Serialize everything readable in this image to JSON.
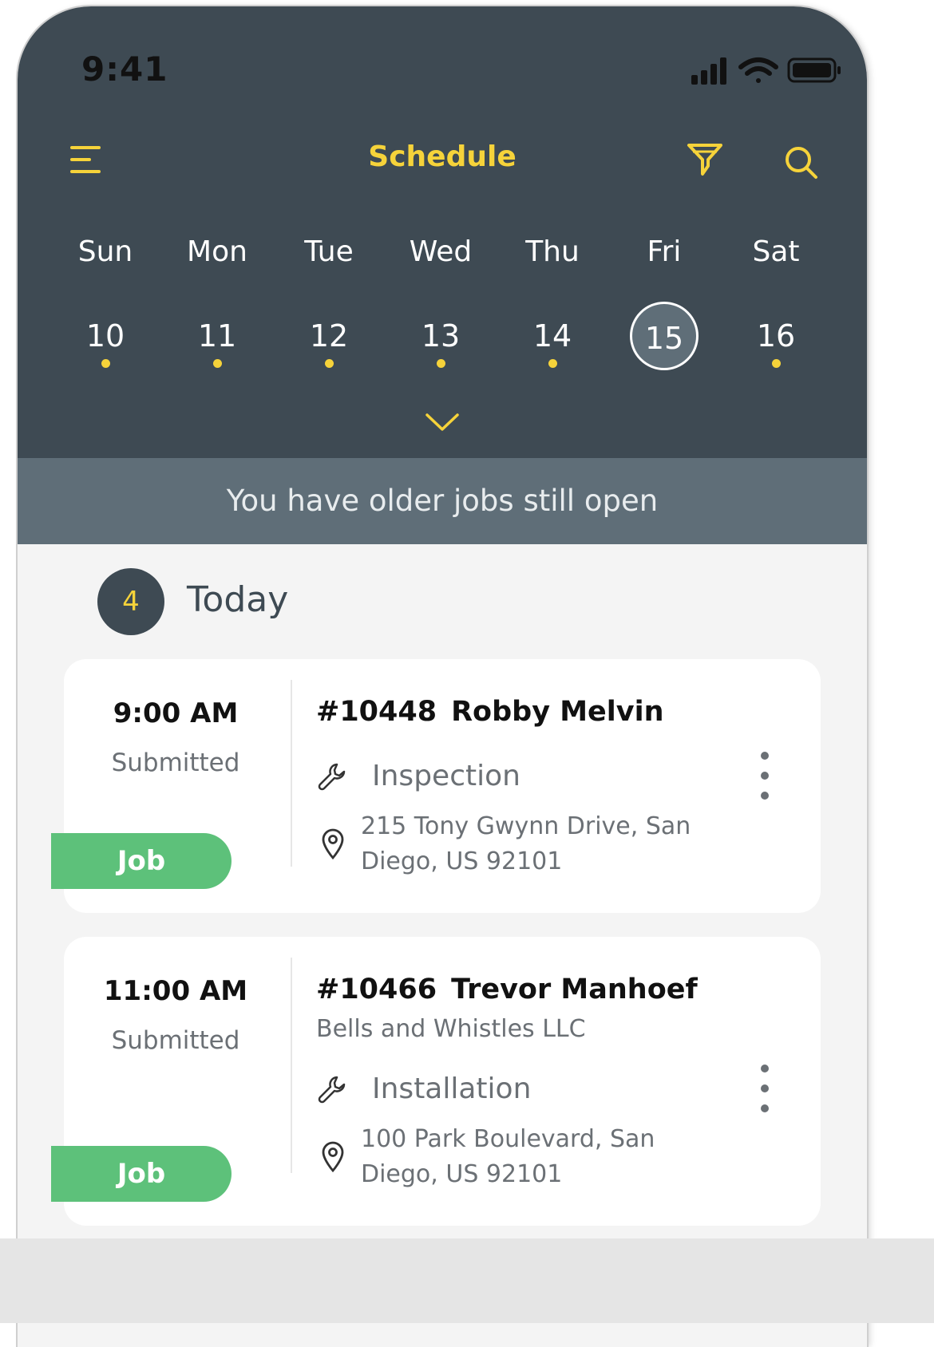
{
  "status_bar": {
    "time": "9:41"
  },
  "header": {
    "title": "Schedule"
  },
  "week": [
    {
      "day": "Sun",
      "date": "10",
      "has_jobs": true
    },
    {
      "day": "Mon",
      "date": "11",
      "has_jobs": true
    },
    {
      "day": "Tue",
      "date": "12",
      "has_jobs": true
    },
    {
      "day": "Wed",
      "date": "13",
      "has_jobs": true
    },
    {
      "day": "Thu",
      "date": "14",
      "has_jobs": true
    },
    {
      "day": "Fri",
      "date": "15",
      "has_jobs": false,
      "selected": true
    },
    {
      "day": "Sat",
      "date": "16",
      "has_jobs": true
    }
  ],
  "banner": {
    "text": "You have older jobs still open"
  },
  "today": {
    "count": "4",
    "label": "Today"
  },
  "jobs": [
    {
      "time": "9:00 AM",
      "status": "Submitted",
      "tag": "Job",
      "number": "#10448",
      "customer": "Robby Melvin",
      "service": "Inspection",
      "address": "215 Tony Gwynn Drive, San Diego, US 92101"
    },
    {
      "time": "11:00 AM",
      "status": "Submitted",
      "tag": "Job",
      "number": "#10466",
      "customer": "Trevor Manhoef",
      "company": "Bells and Whistles LLC",
      "service": "Installation",
      "address": "100 Park Boulevard, San Diego, US 92101"
    }
  ],
  "colors": {
    "header_bg": "#3e4a53",
    "accent_yellow": "#f6d33a",
    "banner_bg": "#5f6e78",
    "job_tag_green": "#5dc17a"
  }
}
